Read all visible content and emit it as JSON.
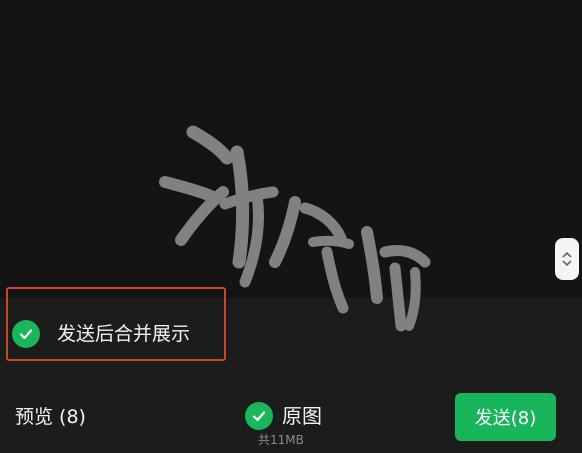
{
  "merge_option": {
    "label": "发送后合并展示",
    "checked": true
  },
  "footer": {
    "preview_label": "预览 (8)",
    "original": {
      "label": "原图",
      "checked": true,
      "size_text": "共11MB"
    },
    "send_label": "发送(8)"
  },
  "icons": {
    "check": "check-icon",
    "scroll_up": "chevron-up-icon",
    "scroll_down": "chevron-down-icon"
  },
  "colors": {
    "accent_green": "#18b55a",
    "highlight_border": "#c8472b",
    "background": "#161616"
  }
}
